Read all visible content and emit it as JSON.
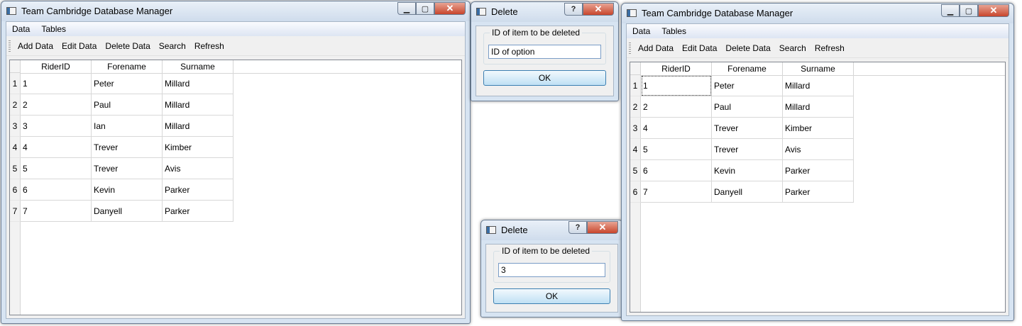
{
  "window_left": {
    "title": "Team Cambridge Database Manager",
    "menus": [
      "Data",
      "Tables"
    ],
    "toolbar": [
      "Add Data",
      "Edit Data",
      "Delete Data",
      "Search",
      "Refresh"
    ],
    "columns": [
      "RiderID",
      "Forename",
      "Surname"
    ],
    "rows": [
      {
        "num": "1",
        "cells": [
          "1",
          "Peter",
          "Millard"
        ]
      },
      {
        "num": "2",
        "cells": [
          "2",
          "Paul",
          "Millard"
        ]
      },
      {
        "num": "3",
        "cells": [
          "3",
          "Ian",
          "Millard"
        ]
      },
      {
        "num": "4",
        "cells": [
          "4",
          "Trever",
          "Kimber"
        ]
      },
      {
        "num": "5",
        "cells": [
          "5",
          "Trever",
          "Avis"
        ]
      },
      {
        "num": "6",
        "cells": [
          "6",
          "Kevin",
          "Parker"
        ]
      },
      {
        "num": "7",
        "cells": [
          "7",
          "Danyell",
          "Parker"
        ]
      }
    ]
  },
  "dialog_top": {
    "title": "Delete",
    "group_label": "ID of item to be deleted",
    "input_value": "ID of option",
    "ok_label": "OK",
    "help_glyph": "?",
    "close_glyph": "✕"
  },
  "dialog_bottom": {
    "title": "Delete",
    "group_label": "ID of item to be deleted",
    "input_value": "3",
    "ok_label": "OK",
    "help_glyph": "?",
    "close_glyph": "✕"
  },
  "window_right": {
    "title": "Team Cambridge Database Manager",
    "menus": [
      "Data",
      "Tables"
    ],
    "toolbar": [
      "Add Data",
      "Edit Data",
      "Delete Data",
      "Search",
      "Refresh"
    ],
    "columns": [
      "RiderID",
      "Forename",
      "Surname"
    ],
    "rows": [
      {
        "num": "1",
        "cells": [
          "1",
          "Peter",
          "Millard"
        ]
      },
      {
        "num": "2",
        "cells": [
          "2",
          "Paul",
          "Millard"
        ]
      },
      {
        "num": "3",
        "cells": [
          "4",
          "Trever",
          "Kimber"
        ]
      },
      {
        "num": "4",
        "cells": [
          "5",
          "Trever",
          "Avis"
        ]
      },
      {
        "num": "5",
        "cells": [
          "6",
          "Kevin",
          "Parker"
        ]
      },
      {
        "num": "6",
        "cells": [
          "7",
          "Danyell",
          "Parker"
        ]
      }
    ]
  },
  "caption_glyphs": {
    "minimize": "▁",
    "maximize": "▢",
    "close": "✕"
  }
}
